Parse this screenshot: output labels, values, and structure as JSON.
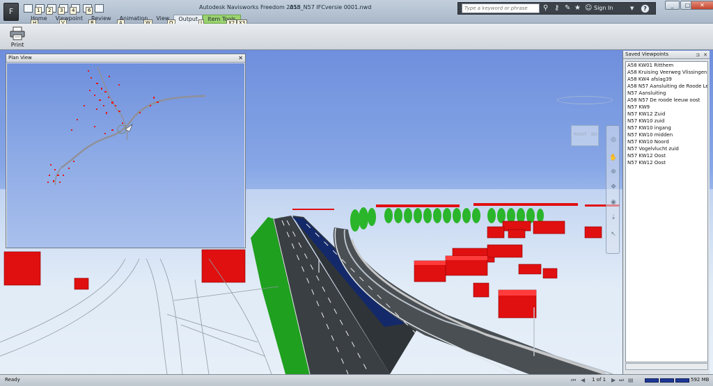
{
  "app": {
    "title": "Autodesk Navisworks Freedom 2015",
    "file_name": "A58_N57 IFCversie 0001.nwd",
    "app_button": "F",
    "window_controls": [
      "_",
      "□",
      "✕"
    ]
  },
  "quick_access_keytips": [
    "1",
    "2",
    "3",
    "4",
    "5",
    "6"
  ],
  "tabs": [
    {
      "label": "Home",
      "keytip": "H"
    },
    {
      "label": "Viewpoint",
      "keytip": "V"
    },
    {
      "label": "Review",
      "keytip": "R"
    },
    {
      "label": "Animation",
      "keytip": "A"
    },
    {
      "label": "View",
      "keytip": "W"
    },
    {
      "label": "Output",
      "keytip": "O",
      "active": true
    },
    {
      "label": "Item Tools",
      "keytip": "J",
      "contextual": true
    }
  ],
  "extra_keytips": [
    "X2",
    "X3"
  ],
  "search": {
    "placeholder": "Type a keyword or phrase"
  },
  "toolbar_icons": [
    "binoculars-icon",
    "key-icon",
    "wrench-icon",
    "star-icon",
    "user-icon"
  ],
  "signin_label": "Sign In",
  "help_label": "?",
  "ribbon": {
    "print_label": "Print"
  },
  "plan_view": {
    "title": "Plan View",
    "close": "✕"
  },
  "saved_viewpoints": {
    "title": "Saved Viewpoints",
    "items": [
      "A58 KW01 Ritthem",
      "A58 Kruising Veerweg Vlissingen",
      "A58 KW4 afslag39",
      "A58 N57 Aansluiting de Roode Leeuw",
      "N57 Aansluiting",
      "A58 N57 De roode leeuw oost",
      "N57 KW9",
      "N57 KW12 Zuid",
      "N57 KW10 zuid",
      "N57 KW10 ingang",
      "N57 KW10 midden",
      "N57 KW10 Noord",
      "N57 Vogelvlucht zuid",
      "N57 KW12 Oost",
      "N57 KW12 Oost"
    ]
  },
  "viewcube": {
    "faces": [
      "RIGHT",
      "BO"
    ]
  },
  "status": {
    "text": "Ready",
    "page": "1 of 1",
    "memory": "592 MB"
  },
  "colors": {
    "sky_top": "#6f8fdd",
    "road": "#3a3f44",
    "verge": "#1fa01f",
    "buildings": "#e01010",
    "trees": "#2bb52b",
    "lane_blue": "#13296a"
  }
}
